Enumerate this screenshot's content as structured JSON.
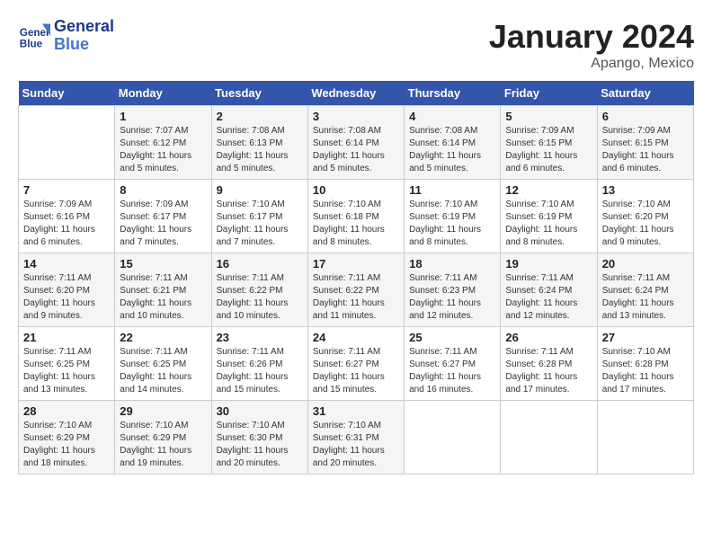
{
  "header": {
    "logo_line1": "General",
    "logo_line2": "Blue",
    "month": "January 2024",
    "location": "Apango, Mexico"
  },
  "weekdays": [
    "Sunday",
    "Monday",
    "Tuesday",
    "Wednesday",
    "Thursday",
    "Friday",
    "Saturday"
  ],
  "weeks": [
    [
      {
        "day": "",
        "info": ""
      },
      {
        "day": "1",
        "info": "Sunrise: 7:07 AM\nSunset: 6:12 PM\nDaylight: 11 hours\nand 5 minutes."
      },
      {
        "day": "2",
        "info": "Sunrise: 7:08 AM\nSunset: 6:13 PM\nDaylight: 11 hours\nand 5 minutes."
      },
      {
        "day": "3",
        "info": "Sunrise: 7:08 AM\nSunset: 6:14 PM\nDaylight: 11 hours\nand 5 minutes."
      },
      {
        "day": "4",
        "info": "Sunrise: 7:08 AM\nSunset: 6:14 PM\nDaylight: 11 hours\nand 5 minutes."
      },
      {
        "day": "5",
        "info": "Sunrise: 7:09 AM\nSunset: 6:15 PM\nDaylight: 11 hours\nand 6 minutes."
      },
      {
        "day": "6",
        "info": "Sunrise: 7:09 AM\nSunset: 6:15 PM\nDaylight: 11 hours\nand 6 minutes."
      }
    ],
    [
      {
        "day": "7",
        "info": "Sunrise: 7:09 AM\nSunset: 6:16 PM\nDaylight: 11 hours\nand 6 minutes."
      },
      {
        "day": "8",
        "info": "Sunrise: 7:09 AM\nSunset: 6:17 PM\nDaylight: 11 hours\nand 7 minutes."
      },
      {
        "day": "9",
        "info": "Sunrise: 7:10 AM\nSunset: 6:17 PM\nDaylight: 11 hours\nand 7 minutes."
      },
      {
        "day": "10",
        "info": "Sunrise: 7:10 AM\nSunset: 6:18 PM\nDaylight: 11 hours\nand 8 minutes."
      },
      {
        "day": "11",
        "info": "Sunrise: 7:10 AM\nSunset: 6:19 PM\nDaylight: 11 hours\nand 8 minutes."
      },
      {
        "day": "12",
        "info": "Sunrise: 7:10 AM\nSunset: 6:19 PM\nDaylight: 11 hours\nand 8 minutes."
      },
      {
        "day": "13",
        "info": "Sunrise: 7:10 AM\nSunset: 6:20 PM\nDaylight: 11 hours\nand 9 minutes."
      }
    ],
    [
      {
        "day": "14",
        "info": "Sunrise: 7:11 AM\nSunset: 6:20 PM\nDaylight: 11 hours\nand 9 minutes."
      },
      {
        "day": "15",
        "info": "Sunrise: 7:11 AM\nSunset: 6:21 PM\nDaylight: 11 hours\nand 10 minutes."
      },
      {
        "day": "16",
        "info": "Sunrise: 7:11 AM\nSunset: 6:22 PM\nDaylight: 11 hours\nand 10 minutes."
      },
      {
        "day": "17",
        "info": "Sunrise: 7:11 AM\nSunset: 6:22 PM\nDaylight: 11 hours\nand 11 minutes."
      },
      {
        "day": "18",
        "info": "Sunrise: 7:11 AM\nSunset: 6:23 PM\nDaylight: 11 hours\nand 12 minutes."
      },
      {
        "day": "19",
        "info": "Sunrise: 7:11 AM\nSunset: 6:24 PM\nDaylight: 11 hours\nand 12 minutes."
      },
      {
        "day": "20",
        "info": "Sunrise: 7:11 AM\nSunset: 6:24 PM\nDaylight: 11 hours\nand 13 minutes."
      }
    ],
    [
      {
        "day": "21",
        "info": "Sunrise: 7:11 AM\nSunset: 6:25 PM\nDaylight: 11 hours\nand 13 minutes."
      },
      {
        "day": "22",
        "info": "Sunrise: 7:11 AM\nSunset: 6:25 PM\nDaylight: 11 hours\nand 14 minutes."
      },
      {
        "day": "23",
        "info": "Sunrise: 7:11 AM\nSunset: 6:26 PM\nDaylight: 11 hours\nand 15 minutes."
      },
      {
        "day": "24",
        "info": "Sunrise: 7:11 AM\nSunset: 6:27 PM\nDaylight: 11 hours\nand 15 minutes."
      },
      {
        "day": "25",
        "info": "Sunrise: 7:11 AM\nSunset: 6:27 PM\nDaylight: 11 hours\nand 16 minutes."
      },
      {
        "day": "26",
        "info": "Sunrise: 7:11 AM\nSunset: 6:28 PM\nDaylight: 11 hours\nand 17 minutes."
      },
      {
        "day": "27",
        "info": "Sunrise: 7:10 AM\nSunset: 6:28 PM\nDaylight: 11 hours\nand 17 minutes."
      }
    ],
    [
      {
        "day": "28",
        "info": "Sunrise: 7:10 AM\nSunset: 6:29 PM\nDaylight: 11 hours\nand 18 minutes."
      },
      {
        "day": "29",
        "info": "Sunrise: 7:10 AM\nSunset: 6:29 PM\nDaylight: 11 hours\nand 19 minutes."
      },
      {
        "day": "30",
        "info": "Sunrise: 7:10 AM\nSunset: 6:30 PM\nDaylight: 11 hours\nand 20 minutes."
      },
      {
        "day": "31",
        "info": "Sunrise: 7:10 AM\nSunset: 6:31 PM\nDaylight: 11 hours\nand 20 minutes."
      },
      {
        "day": "",
        "info": ""
      },
      {
        "day": "",
        "info": ""
      },
      {
        "day": "",
        "info": ""
      }
    ]
  ]
}
